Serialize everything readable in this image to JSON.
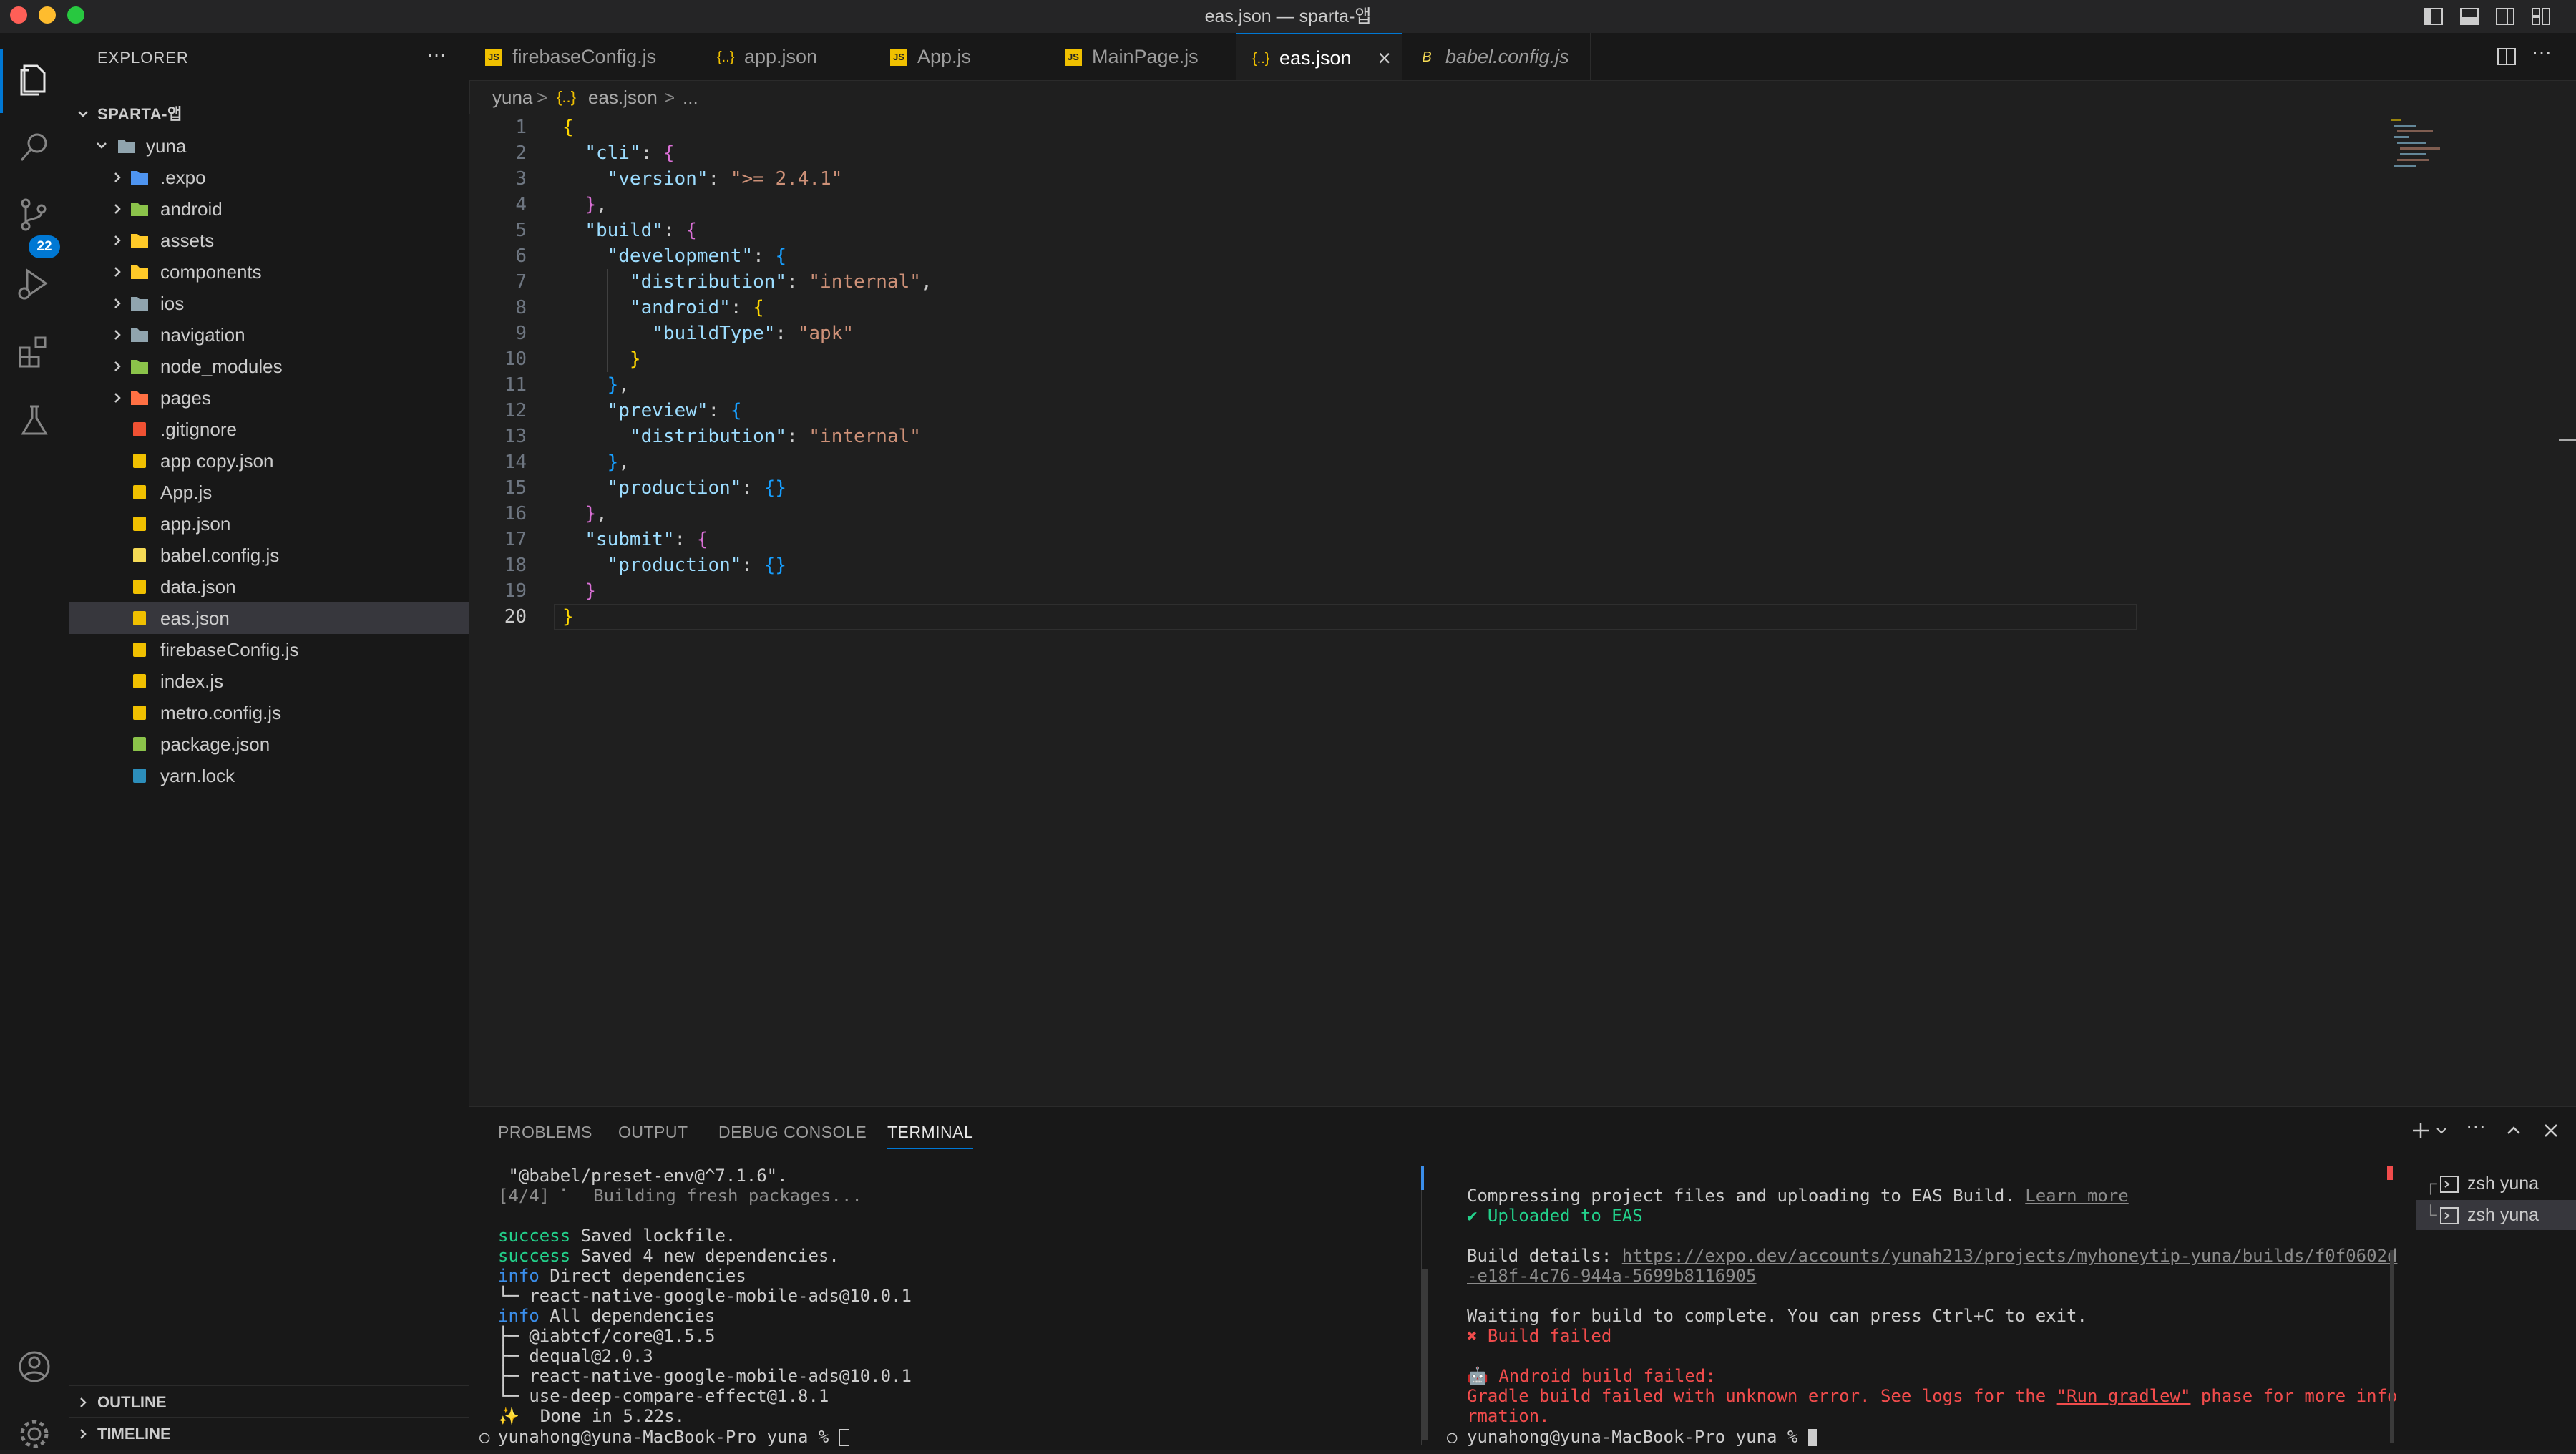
{
  "window": {
    "title": "eas.json — sparta-앱",
    "traffic": {
      "close": "#ff5f57",
      "minimize": "#febc2e",
      "maximize": "#28c840"
    }
  },
  "activity_bar": {
    "icons": [
      "explorer-icon",
      "search-icon",
      "source-control-icon",
      "run-debug-icon",
      "extensions-icon",
      "testing-icon",
      "account-icon",
      "settings-gear-icon"
    ],
    "scm_badge": "22"
  },
  "sidebar": {
    "title": "EXPLORER",
    "more": "···",
    "workspace": "SPARTA-앱",
    "root_folder": "yuna",
    "items": [
      {
        "label": ".expo",
        "kind": "folder",
        "icon_color": "#4e94f0"
      },
      {
        "label": "android",
        "kind": "folder",
        "icon_color": "#8bc34a"
      },
      {
        "label": "assets",
        "kind": "folder",
        "icon_color": "#ffca28"
      },
      {
        "label": "components",
        "kind": "folder",
        "icon_color": "#ffca28"
      },
      {
        "label": "ios",
        "kind": "folder",
        "icon_color": "#90a4ae"
      },
      {
        "label": "navigation",
        "kind": "folder",
        "icon_color": "#90a4ae"
      },
      {
        "label": "node_modules",
        "kind": "folder",
        "icon_color": "#8bc34a"
      },
      {
        "label": "pages",
        "kind": "folder",
        "icon_color": "#ff7043"
      },
      {
        "label": ".gitignore",
        "kind": "file",
        "icon_color": "#f05133"
      },
      {
        "label": "app copy.json",
        "kind": "file",
        "icon_color": "#f0c000"
      },
      {
        "label": "App.js",
        "kind": "file",
        "icon_color": "#f0c000"
      },
      {
        "label": "app.json",
        "kind": "file",
        "icon_color": "#f0c000"
      },
      {
        "label": "babel.config.js",
        "kind": "file",
        "icon_color": "#f5da55"
      },
      {
        "label": "data.json",
        "kind": "file",
        "icon_color": "#f0c000"
      },
      {
        "label": "eas.json",
        "kind": "file",
        "icon_color": "#f0c000",
        "selected": true
      },
      {
        "label": "firebaseConfig.js",
        "kind": "file",
        "icon_color": "#f0c000"
      },
      {
        "label": "index.js",
        "kind": "file",
        "icon_color": "#f0c000"
      },
      {
        "label": "metro.config.js",
        "kind": "file",
        "icon_color": "#f0c000"
      },
      {
        "label": "package.json",
        "kind": "file",
        "icon_color": "#8bc34a"
      },
      {
        "label": "yarn.lock",
        "kind": "file",
        "icon_color": "#2c8ebb"
      }
    ],
    "outline": "OUTLINE",
    "timeline": "TIMELINE"
  },
  "tabs": [
    {
      "label": "firebaseConfig.js",
      "icon": "JS"
    },
    {
      "label": "app.json",
      "icon": "{..}"
    },
    {
      "label": "App.js",
      "icon": "JS"
    },
    {
      "label": "MainPage.js",
      "icon": "JS"
    },
    {
      "label": "eas.json",
      "icon": "{..}",
      "active": true,
      "close": "×"
    },
    {
      "label": "babel.config.js",
      "icon": "B",
      "italic": true
    }
  ],
  "breadcrumb": {
    "folder": "yuna",
    "sep": ">",
    "file": "eas.json",
    "more": "..."
  },
  "editor": {
    "lines": [
      "1",
      "2",
      "3",
      "4",
      "5",
      "6",
      "7",
      "8",
      "9",
      "10",
      "11",
      "12",
      "13",
      "14",
      "15",
      "16",
      "17",
      "18",
      "19",
      "20"
    ],
    "active_line": "20",
    "code": {
      "cli": "\"cli\"",
      "version_key": "\"version\"",
      "version_val": "\">= 2.4.1\"",
      "build": "\"build\"",
      "development": "\"development\"",
      "distribution": "\"distribution\"",
      "internal": "\"internal\"",
      "android": "\"android\"",
      "buildType": "\"buildType\"",
      "apk": "\"apk\"",
      "preview": "\"preview\"",
      "production": "\"production\"",
      "submit": "\"submit\""
    }
  },
  "panel": {
    "tabs": [
      "PROBLEMS",
      "OUTPUT",
      "DEBUG CONSOLE",
      "TERMINAL"
    ],
    "active_tab": "TERMINAL",
    "left_terminal": [
      " \"@babel/preset-env@^7.1.6\".",
      "[4/4] ⠁  Building fresh packages...",
      "",
      "success Saved lockfile.",
      "success Saved 4 new dependencies.",
      "info Direct dependencies",
      "└─ react-native-google-mobile-ads@10.0.1",
      "info All dependencies",
      "├─ @iabtcf/core@1.5.5",
      "├─ dequal@2.0.3",
      "├─ react-native-google-mobile-ads@10.0.1",
      "└─ use-deep-compare-effect@1.8.1",
      "✨  Done in 5.22s."
    ],
    "left_prompt": "yunahong@yuna-MacBook-Pro yuna % ",
    "right_terminal": {
      "line1": "Compressing project files and uploading to EAS Build. ",
      "learn_more": "Learn more",
      "uploaded": "✔ Uploaded to EAS",
      "build_details_label": "Build details: ",
      "build_url_1": "https://expo.dev/accounts/yunah213/projects/myhoneytip-yuna/builds/f0f0602d",
      "build_url_2": "-e18f-4c76-944a-5699b8116905",
      "waiting": "Waiting for build to complete. You can press Ctrl+C to exit.",
      "build_failed": "✖ Build failed",
      "android_failed": "🤖 Android build failed:",
      "gradle_1a": "Gradle build failed with unknown error. See logs for the ",
      "gradle_link": "\"Run gradlew\"",
      "gradle_1b": " phase for more info",
      "gradle_2": "rmation."
    },
    "right_prompt": "yunahong@yuna-MacBook-Pro yuna % ",
    "terminal_list": [
      {
        "label": "zsh yuna"
      },
      {
        "label": "zsh yuna",
        "selected": true
      }
    ]
  }
}
